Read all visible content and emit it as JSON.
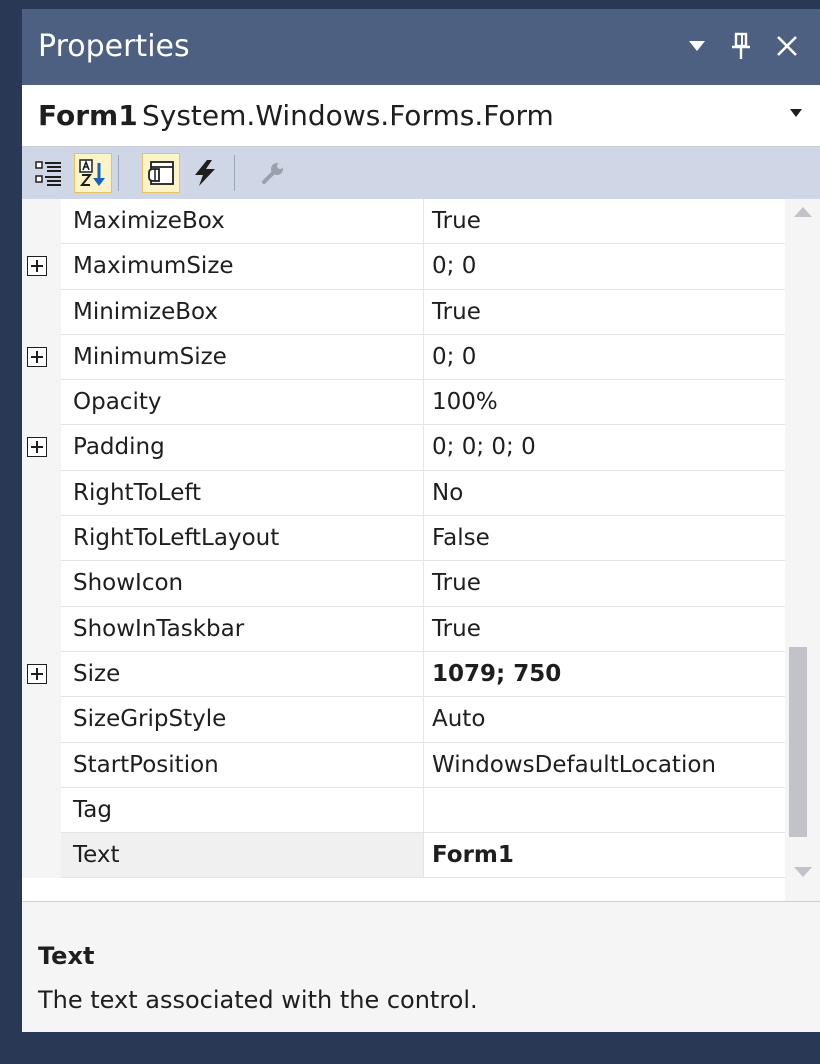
{
  "window": {
    "title": "Properties",
    "icons": {
      "dropdown": "triangle-down-icon",
      "pin": "pin-icon",
      "close": "close-icon"
    }
  },
  "object_selector": {
    "name": "Form1",
    "type": "System.Windows.Forms.Form",
    "icon": "chevron-down-icon"
  },
  "toolbar": {
    "buttons": [
      {
        "id": "categorized",
        "icon": "categorized-icon",
        "checked": false
      },
      {
        "id": "alphabetical",
        "icon": "sort-az-icon",
        "checked": true
      },
      {
        "id": "properties",
        "icon": "properties-icon",
        "checked": true
      },
      {
        "id": "events",
        "icon": "lightning-icon",
        "checked": false
      },
      {
        "id": "property-pages",
        "icon": "wrench-icon",
        "checked": false
      }
    ]
  },
  "grid": {
    "rows": [
      {
        "name": "MaximizeBox",
        "value": "True",
        "expandable": false,
        "bold": false
      },
      {
        "name": "MaximumSize",
        "value": "0; 0",
        "expandable": true,
        "bold": false
      },
      {
        "name": "MinimizeBox",
        "value": "True",
        "expandable": false,
        "bold": false
      },
      {
        "name": "MinimumSize",
        "value": "0; 0",
        "expandable": true,
        "bold": false
      },
      {
        "name": "Opacity",
        "value": "100%",
        "expandable": false,
        "bold": false
      },
      {
        "name": "Padding",
        "value": "0; 0; 0; 0",
        "expandable": true,
        "bold": false
      },
      {
        "name": "RightToLeft",
        "value": "No",
        "expandable": false,
        "bold": false
      },
      {
        "name": "RightToLeftLayout",
        "value": "False",
        "expandable": false,
        "bold": false
      },
      {
        "name": "ShowIcon",
        "value": "True",
        "expandable": false,
        "bold": false
      },
      {
        "name": "ShowInTaskbar",
        "value": "True",
        "expandable": false,
        "bold": false
      },
      {
        "name": "Size",
        "value": "1079; 750",
        "expandable": true,
        "bold": true
      },
      {
        "name": "SizeGripStyle",
        "value": "Auto",
        "expandable": false,
        "bold": false
      },
      {
        "name": "StartPosition",
        "value": "WindowsDefaultLocation",
        "expandable": false,
        "bold": false
      },
      {
        "name": "Tag",
        "value": "",
        "expandable": false,
        "bold": false
      },
      {
        "name": "Text",
        "value": "Form1",
        "expandable": false,
        "bold": true,
        "selected": true
      }
    ],
    "selected_row": "Text"
  },
  "description": {
    "title": "Text",
    "text": "The text associated with the control."
  },
  "colors": {
    "title_bar": "#4d6082",
    "toolbar": "#cfd6e5",
    "background": "#293955",
    "checked_button": "#fcf4c9"
  }
}
